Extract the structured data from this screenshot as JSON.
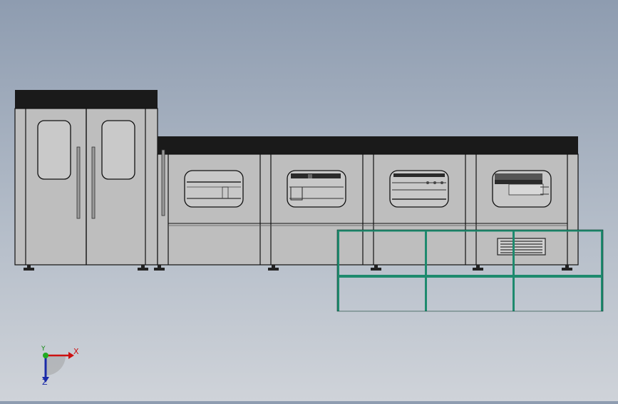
{
  "viewport": {
    "background_top": "#8e9cb0",
    "background_bottom": "#cfd3d9"
  },
  "machine": {
    "body_color": "#bfbfbf",
    "roof_color": "#1a1a1a",
    "outline_color": "#111111",
    "guardrail_color": "#1e8a6e",
    "vent_color": "#333333"
  },
  "triad": {
    "x_label": "X",
    "y_label": "Y",
    "z_label": "Z",
    "x_color": "#cc1111",
    "y_color": "#118811",
    "z_color": "#1a2aa8"
  }
}
